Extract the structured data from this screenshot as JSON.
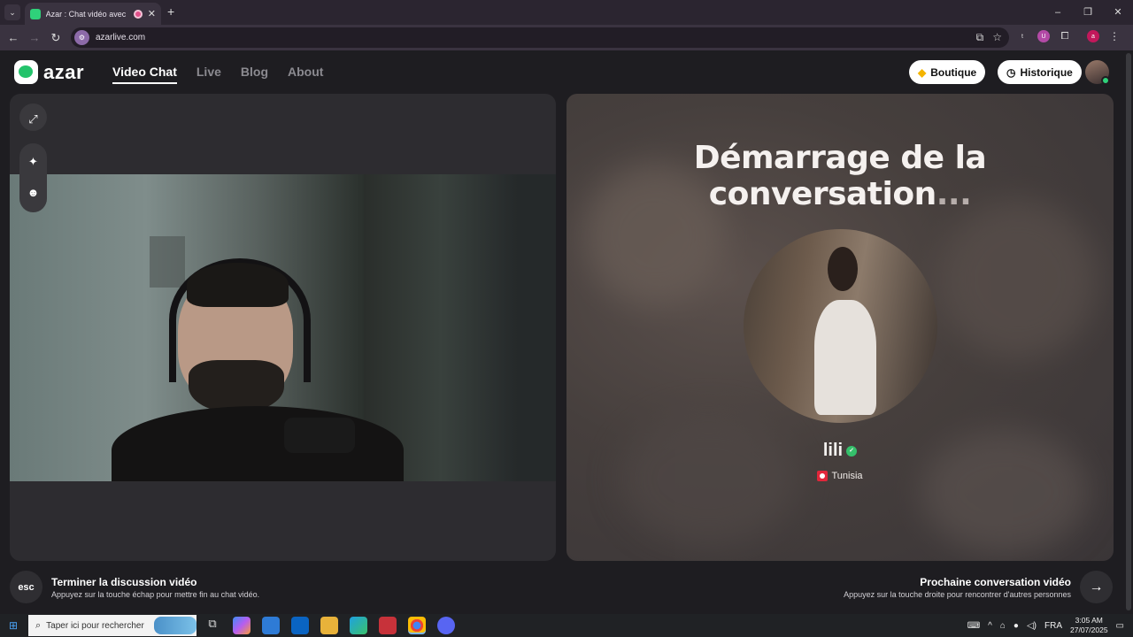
{
  "browser": {
    "tab_title": "Azar : Chat vidéo avec de n",
    "url": "azarlive.com",
    "window_controls": [
      "–",
      "❐",
      "✕"
    ]
  },
  "site": {
    "logo_text": "azar",
    "nav": [
      {
        "label": "Video Chat",
        "active": true
      },
      {
        "label": "Live",
        "active": false
      },
      {
        "label": "Blog",
        "active": false
      },
      {
        "label": "About",
        "active": false
      }
    ],
    "boutique_label": "Boutique",
    "historique_label": "Historique"
  },
  "connecting": {
    "title": "Démarrage de la conversation",
    "title_dots": "...",
    "match_name": "lili",
    "country": "Tunisia"
  },
  "footer": {
    "esc_key": "esc",
    "end_title": "Terminer la discussion vidéo",
    "end_sub": "Appuyez sur la touche échap pour mettre fin au chat vidéo.",
    "next_title": "Prochaine conversation vidéo",
    "next_sub": "Appuyez sur la touche droite pour rencontrer d'autres personnes"
  },
  "taskbar": {
    "search_placeholder": "Taper ici pour rechercher",
    "language": "FRA",
    "time": "3:05 AM",
    "date": "27/07/2025"
  },
  "colors": {
    "brand_green": "#23c36b",
    "page_bg": "#1e1d21",
    "panel_bg": "#2d2c30"
  }
}
